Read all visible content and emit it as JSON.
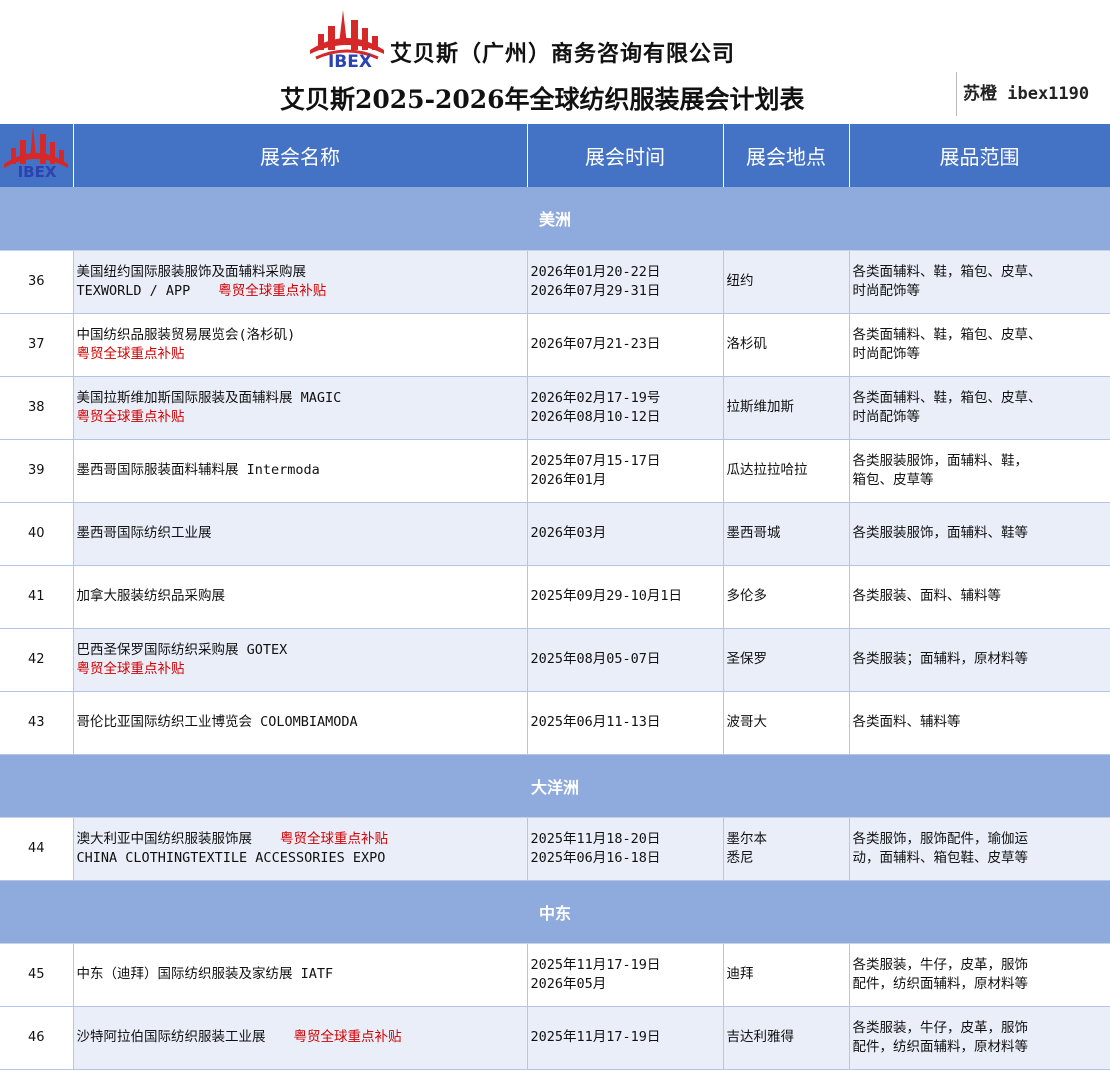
{
  "header": {
    "logo_text": "IBEX",
    "company": "艾贝斯（广州）商务咨询有限公司",
    "title": "艾贝斯2025-2026年全球纺织服装展会计划表",
    "contact": "苏橙 ibex1190"
  },
  "columns": {
    "name": "展会名称",
    "date": "展会时间",
    "location": "展会地点",
    "scope": "展品范围"
  },
  "regions": {
    "americas": "美洲",
    "oceania": "大洋洲",
    "middle_east": "中东"
  },
  "rows": [
    {
      "no": "36",
      "name1": "美国纽约国际服装服饰及面辅料采购展",
      "name2": "TEXWORLD / APP",
      "tag": "粤贸全球重点补贴",
      "date1": "2026年01月20-22日",
      "date2": "2026年07月29-31日",
      "loc1": "纽约",
      "loc2": "",
      "scope1": "各类面辅料、鞋，箱包、皮草、",
      "scope2": "时尚配饰等"
    },
    {
      "no": "37",
      "name1": "中国纺织品服装贸易展览会(洛杉矶)",
      "name2": "",
      "tag": "粤贸全球重点补贴",
      "date1": "2026年07月21-23日",
      "date2": "",
      "loc1": "洛杉矶",
      "loc2": "",
      "scope1": "各类面辅料、鞋，箱包、皮草、",
      "scope2": "时尚配饰等"
    },
    {
      "no": "38",
      "name1": "美国拉斯维加斯国际服装及面辅料展 MAGIC",
      "name2": "",
      "tag": "粤贸全球重点补贴",
      "date1": "2026年02月17-19号",
      "date2": "2026年08月10-12日",
      "loc1": "拉斯维加斯",
      "loc2": "",
      "scope1": "各类面辅料、鞋，箱包、皮草、",
      "scope2": "时尚配饰等"
    },
    {
      "no": "39",
      "name1": "墨西哥国际服装面料辅料展 Intermoda",
      "name2": "",
      "tag": "",
      "date1": "2025年07月15-17日",
      "date2": "2026年01月",
      "loc1": "瓜达拉拉哈拉",
      "loc2": "",
      "scope1": "各类服装服饰，面辅料、鞋，",
      "scope2": "箱包、皮草等"
    },
    {
      "no": "40",
      "name1": "墨西哥国际纺织工业展",
      "name2": "",
      "tag": "",
      "date1": "2026年03月",
      "date2": "",
      "loc1": "墨西哥城",
      "loc2": "",
      "scope1": "各类服装服饰，面辅料、鞋等",
      "scope2": ""
    },
    {
      "no": "41",
      "name1": "加拿大服装纺织品采购展",
      "name2": "",
      "tag": "",
      "date1": "2025年09月29-10月1日",
      "date2": "",
      "loc1": "多伦多",
      "loc2": "",
      "scope1": "各类服装、面料、辅料等",
      "scope2": ""
    },
    {
      "no": "42",
      "name1": "巴西圣保罗国际纺织采购展 GOTEX",
      "name2": "",
      "tag": "粤贸全球重点补贴",
      "date1": "2025年08月05-07日",
      "date2": "",
      "loc1": "圣保罗",
      "loc2": "",
      "scope1": "各类服装；面辅料，原材料等",
      "scope2": ""
    },
    {
      "no": "43",
      "name1": "哥伦比亚国际纺织工业博览会 COLOMBIAMODA",
      "name2": "",
      "tag": "",
      "date1": "2025年06月11-13日",
      "date2": "",
      "loc1": "波哥大",
      "loc2": "",
      "scope1": "各类面料、辅料等",
      "scope2": ""
    },
    {
      "no": "44",
      "name1": "澳大利亚中国纺织服装服饰展",
      "name2": "CHINA CLOTHINGTEXTILE ACCESSORIES EXPO",
      "tag": "粤贸全球重点补贴",
      "date1": "2025年11月18-20日",
      "date2": "2025年06月16-18日",
      "loc1": "墨尔本",
      "loc2": "悉尼",
      "scope1": "各类服饰，服饰配件，瑜伽运",
      "scope2": "动，面辅料、箱包鞋、皮草等"
    },
    {
      "no": "45",
      "name1": "中东（迪拜）国际纺织服装及家纺展 IATF",
      "name2": "",
      "tag": "",
      "date1": "2025年11月17-19日",
      "date2": "2026年05月",
      "loc1": "迪拜",
      "loc2": "",
      "scope1": "各类服装，牛仔，皮革，服饰",
      "scope2": "配件，纺织面辅料，原材料等"
    },
    {
      "no": "46",
      "name1": "沙特阿拉伯国际纺织服装工业展",
      "name2": "",
      "tag": "粤贸全球重点补贴",
      "date1": "2025年11月17-19日",
      "date2": "",
      "loc1": "吉达利雅得",
      "loc2": "",
      "scope1": "各类服装，牛仔，皮革，服饰",
      "scope2": "配件，纺织面辅料，原材料等"
    }
  ],
  "colors": {
    "header_blue": "#4472c4",
    "region_blue": "#8faadc",
    "row_tint": "#e9eef8",
    "subsidy_red": "#d40000"
  }
}
